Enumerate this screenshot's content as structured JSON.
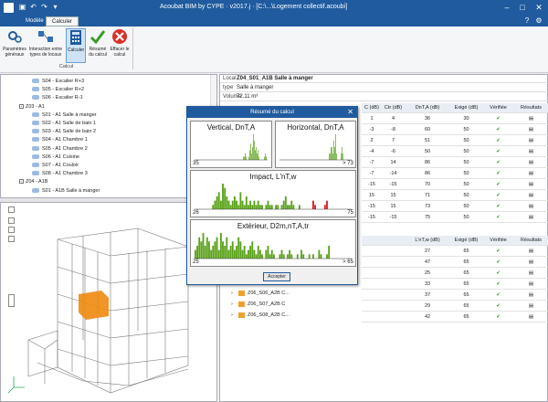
{
  "app": {
    "title": "Acoubat BIM by CYPE · v2017.j · [C:\\...\\Logement collectif.acoubi]"
  },
  "tabs": [
    "Modèle",
    "Calculer"
  ],
  "ribbon": {
    "group_label": "Calcul",
    "buttons": [
      {
        "label": "Paramètres\ngénéraux",
        "icon": "settings-gears-icon"
      },
      {
        "label": "Interaction entre\ntypes de locaux",
        "icon": "interaction-icon"
      },
      {
        "label": "Calculer",
        "icon": "calculator-icon"
      },
      {
        "label": "Résumé\ndu calcul",
        "icon": "summary-check-icon"
      },
      {
        "label": "Effacer le\ncalcul",
        "icon": "delete-icon"
      }
    ]
  },
  "tree": {
    "items": [
      {
        "label": "S04 - Escalier R+3",
        "level": 2
      },
      {
        "label": "S05 - Escalier R+2",
        "level": 2
      },
      {
        "label": "S06 - Escalier R-1",
        "level": 2
      },
      {
        "label": "Z03 - A1",
        "level": 1,
        "expander": "-"
      },
      {
        "label": "S01 - A1 Salle à manger",
        "level": 2
      },
      {
        "label": "S02 - A1 Salle de bain 1",
        "level": 2
      },
      {
        "label": "S03 - A1 Salle de bain 2",
        "level": 2
      },
      {
        "label": "S04 - A1 Chambre 1",
        "level": 2
      },
      {
        "label": "S05 - A1 Chambre 2",
        "level": 2
      },
      {
        "label": "S06 - A1 Cuisine",
        "level": 2
      },
      {
        "label": "S07 - A1 Couloir",
        "level": 2
      },
      {
        "label": "S08 - A1 Chambre 3",
        "level": 2
      },
      {
        "label": "Z04 - A1B",
        "level": 1,
        "expander": "-"
      },
      {
        "label": "S01 - A1B Salle à manger",
        "level": 2
      }
    ]
  },
  "local": {
    "label_local": "Local",
    "value_local": "Z04_S01_A1B Salle à manger",
    "label_type": "type",
    "value_type": "Salle à manger",
    "label_volume": "Volume",
    "value_volume": "72.11 m³"
  },
  "grid_top": {
    "header": [
      "C (dB)",
      "Ctr (dB)",
      "DnT,A (dB)",
      "Exigé (dB)",
      "Vérifiée",
      "Résultats"
    ],
    "rows": [
      [
        "1",
        "4",
        "36",
        "30",
        "✔",
        "▤"
      ],
      [
        "-3",
        "-8",
        "60",
        "50",
        "✔",
        "▤"
      ],
      [
        "2",
        "7",
        "51",
        "50",
        "✔",
        "▤"
      ],
      [
        "-4",
        "-6",
        "50",
        "50",
        "✔",
        "▤"
      ],
      [
        "-7",
        "14",
        "86",
        "50",
        "✔",
        "▤"
      ],
      [
        "-7",
        "-14",
        "86",
        "50",
        "✔",
        "▤"
      ],
      [
        "-15",
        "-15",
        "70",
        "50",
        "✔",
        "▤"
      ],
      [
        "15",
        "15",
        "71",
        "50",
        "✔",
        "▤"
      ],
      [
        "-15",
        "15",
        "73",
        "50",
        "✔",
        "▤"
      ],
      [
        "-15",
        "-15",
        "75",
        "50",
        "✔",
        "▤"
      ]
    ]
  },
  "grid_bottom": {
    "header": [
      "L'nT,w (dB)",
      "Exigé (dB)",
      "Vérifiée",
      "Résultats"
    ],
    "rows": [
      [
        "27",
        "65",
        "✔",
        "▤"
      ],
      [
        "47",
        "65",
        "✔",
        "▤"
      ],
      [
        "25",
        "65",
        "✔",
        "▤"
      ],
      [
        "33",
        "65",
        "✔",
        "▤"
      ],
      [
        "37",
        "65",
        "✔",
        "▤"
      ],
      [
        "29",
        "65",
        "✔",
        "▤"
      ],
      [
        "42",
        "65",
        "✔",
        "▤"
      ]
    ],
    "labels": [
      "Z06_S06_A2B C...",
      "Z06_S07_A2B C",
      "Z06_S08_A2B C..."
    ]
  },
  "modal": {
    "title": "Résumé du calcul",
    "accept_label": "Accepter",
    "panels": [
      {
        "title": "Vertical, DnT,A",
        "min": "35",
        "max": ""
      },
      {
        "title": "Horizontal, DnT,A",
        "min": "",
        "max": "> 73"
      },
      {
        "title": "Impact, L'nT,w",
        "min": "26",
        "max": "75"
      },
      {
        "title": "Extérieur, D2m,nT,A,tr",
        "min": "25",
        "max": "> 65"
      }
    ]
  },
  "chart_data": [
    {
      "type": "bar",
      "title": "Vertical, DnT,A",
      "values": [
        0,
        0,
        0,
        0,
        0,
        0,
        0,
        0,
        0,
        0,
        0,
        0,
        0,
        0,
        0,
        0,
        0,
        0,
        0,
        0,
        0,
        0,
        0,
        0,
        0,
        0,
        0,
        0,
        0,
        0,
        0,
        0,
        0,
        0,
        0,
        0,
        0,
        0,
        0,
        0,
        0,
        0,
        0,
        0,
        0,
        0,
        0,
        0,
        0,
        0,
        0,
        0,
        0,
        1,
        1,
        2,
        1,
        0,
        0,
        1,
        3,
        5,
        2,
        4,
        8,
        6,
        3,
        4,
        2,
        3,
        1,
        0,
        0,
        0,
        0,
        0,
        1,
        2,
        1,
        0
      ]
    },
    {
      "type": "bar",
      "title": "Horizontal, DnT,A",
      "values": [
        0,
        0,
        0,
        0,
        0,
        0,
        0,
        0,
        0,
        0,
        0,
        0,
        0,
        0,
        0,
        0,
        0,
        0,
        0,
        0,
        0,
        0,
        0,
        0,
        0,
        0,
        0,
        0,
        0,
        0,
        0,
        0,
        0,
        0,
        0,
        0,
        0,
        0,
        0,
        0,
        0,
        0,
        0,
        0,
        0,
        0,
        0,
        0,
        0,
        0,
        0,
        0,
        0,
        0,
        0,
        1,
        1,
        2,
        2,
        1,
        3,
        2,
        4,
        1,
        0,
        0,
        0,
        0,
        1,
        2,
        1,
        0,
        0,
        0,
        0,
        0,
        0,
        0,
        0,
        0
      ]
    },
    {
      "type": "bar",
      "title": "Impact, L'nT,w",
      "values": [
        0,
        0,
        0,
        0,
        0,
        0,
        0,
        0,
        0,
        1,
        2,
        3,
        4,
        2,
        6,
        5,
        3,
        2,
        1,
        2,
        3,
        2,
        1,
        4,
        2,
        1,
        3,
        1,
        2,
        1,
        2,
        1,
        2,
        1,
        1,
        0,
        1,
        2,
        1,
        1,
        0,
        1,
        1,
        0,
        1,
        2,
        3,
        1,
        1,
        2,
        1,
        0,
        0,
        1,
        0,
        0,
        0,
        0,
        0,
        0,
        2,
        1,
        0,
        0,
        0,
        0,
        1,
        2,
        0,
        0,
        0,
        0,
        0,
        0,
        0,
        0,
        0,
        0,
        0,
        0
      ],
      "red_from": 60
    },
    {
      "type": "bar",
      "title": "Extérieur, D2m,nT,A,tr",
      "values": [
        2,
        3,
        5,
        4,
        6,
        3,
        5,
        4,
        2,
        3,
        4,
        5,
        2,
        6,
        4,
        3,
        5,
        2,
        3,
        4,
        2,
        3,
        5,
        4,
        2,
        3,
        1,
        2,
        3,
        4,
        2,
        1,
        3,
        2,
        1,
        0,
        2,
        3,
        1,
        2,
        1,
        0,
        0,
        1,
        2,
        1,
        0,
        1,
        2,
        1,
        0,
        0,
        1,
        0,
        2,
        1,
        0,
        0,
        1,
        0,
        1,
        0,
        0,
        2,
        1,
        0,
        0,
        1,
        3,
        0,
        0,
        0,
        0,
        0,
        0,
        0,
        0,
        0,
        0,
        0
      ]
    }
  ]
}
